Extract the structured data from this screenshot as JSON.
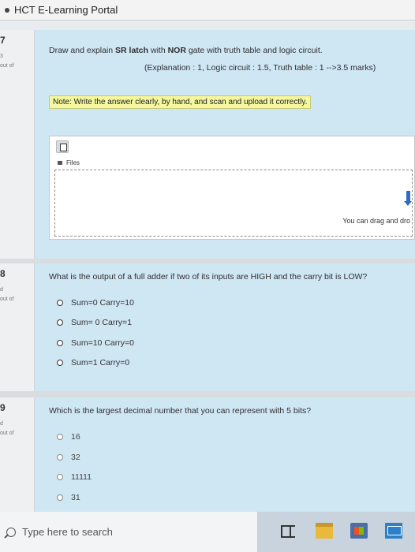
{
  "app": {
    "title": "HCT E-Learning Portal"
  },
  "questions": [
    {
      "number": "7",
      "mark_fragment": "3",
      "out_of": "out of",
      "text_prefix": "Draw and explain ",
      "text_bold_1": "SR latch",
      "text_middle": " with ",
      "text_bold_2": "NOR",
      "text_suffix": " gate with truth table and logic circuit.",
      "marks_line": "(Explanation : 1, Logic circuit : 1.5, Truth table : 1 -->3.5 marks)",
      "note": "Note: Write the answer clearly, by hand, and scan and upload it correctly.",
      "files_label": "Files",
      "drop_text": "You can drag and dro"
    },
    {
      "number": "8",
      "mark_fragment": "d",
      "out_of": "out of",
      "text": "What is the output of a full adder if two of its inputs are HIGH and the carry bit is LOW?",
      "options": [
        "Sum=0 Carry=10",
        "Sum= 0  Carry=1",
        "Sum=10  Carry=0",
        "Sum=1  Carry=0"
      ]
    },
    {
      "number": "9",
      "mark_fragment": "d",
      "out_of": "out of",
      "text": "Which is the largest decimal number that you can represent with 5 bits?",
      "options": [
        "16",
        "32",
        "11111",
        "31"
      ]
    }
  ],
  "taskbar": {
    "search_placeholder": "Type here to search"
  },
  "colors": {
    "panel": "#cfe6f3",
    "note_highlight": "#f4f79d",
    "sidebar": "#eef0f1"
  }
}
